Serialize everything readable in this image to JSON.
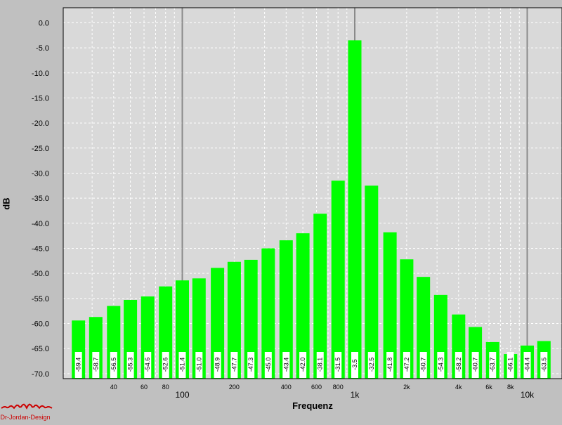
{
  "chart_data": {
    "type": "bar",
    "xlabel": "Frequenz",
    "ylabel": "dB",
    "ylim": [
      -71,
      3
    ],
    "yticks": [
      0,
      -5,
      -10,
      -15,
      -20,
      -25,
      -30,
      -35,
      -40,
      -45,
      -50,
      -55,
      -60,
      -65,
      -70
    ],
    "xscale": "log",
    "grid": true,
    "bar_color": "#00ff00",
    "background": "#d9d9d9",
    "x_tick_labels_major": [
      {
        "f": 100,
        "label": "100"
      },
      {
        "f": 1000,
        "label": "1k"
      },
      {
        "f": 10000,
        "label": "10k"
      }
    ],
    "x_tick_labels_minor": [
      {
        "f": 40,
        "label": "40"
      },
      {
        "f": 60,
        "label": "60"
      },
      {
        "f": 80,
        "label": "80"
      },
      {
        "f": 200,
        "label": "200"
      },
      {
        "f": 400,
        "label": "400"
      },
      {
        "f": 600,
        "label": "600"
      },
      {
        "f": 800,
        "label": "800"
      },
      {
        "f": 2000,
        "label": "2k"
      },
      {
        "f": 4000,
        "label": "4k"
      },
      {
        "f": 6000,
        "label": "6k"
      },
      {
        "f": 8000,
        "label": "8k"
      }
    ],
    "frequencies": [
      25,
      31.5,
      40,
      50,
      63,
      80,
      100,
      125,
      160,
      200,
      250,
      315,
      400,
      500,
      630,
      800,
      1000,
      1250,
      1600,
      2000,
      2500,
      3150,
      4000,
      5000,
      6300,
      8000,
      10000,
      12500
    ],
    "values": [
      -59.4,
      -58.7,
      -56.5,
      -55.3,
      -54.6,
      -52.6,
      -51.4,
      -51.0,
      -48.9,
      -47.7,
      -47.3,
      -45.0,
      -43.4,
      -42.0,
      -38.1,
      -31.5,
      -3.5,
      -32.5,
      -41.8,
      -47.2,
      -50.7,
      -54.3,
      -58.2,
      -60.7,
      -63.7,
      -66.1,
      -64.4,
      -63.5
    ],
    "labels": [
      "-59.4",
      "-58.7",
      "-56.5",
      "-55.3",
      "-54.6",
      "-52.6",
      "-51.4",
      "-51.0",
      "-48.9",
      "-47.7",
      "-47.3",
      "-45.0",
      "-43.4",
      "-42.0",
      "-38.1",
      "-31.5",
      "-3.5",
      "-32.5",
      "-41.8",
      "-47.2",
      "-50.7",
      "-54.3",
      "-58.2",
      "-60.7",
      "-63.7",
      "-66.1",
      "-64.4",
      "-63.5"
    ]
  },
  "logo": {
    "text": "Dr-Jordan-Design",
    "color": "#cc0000"
  }
}
